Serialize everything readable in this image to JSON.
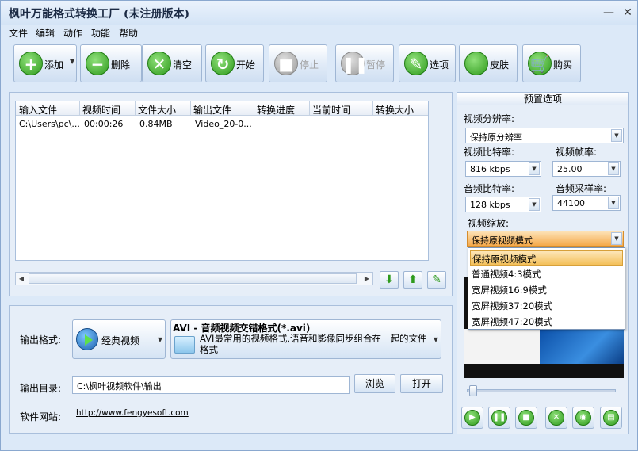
{
  "window": {
    "title": "枫叶万能格式转换工厂  (未注册版本)"
  },
  "menu": [
    "文件",
    "编辑",
    "动作",
    "功能",
    "帮助"
  ],
  "toolbar": [
    {
      "label": "添加",
      "icon": "plus-icon"
    },
    {
      "label": "删除",
      "icon": "minus-icon"
    },
    {
      "label": "清空",
      "icon": "clear-icon"
    },
    {
      "label": "开始",
      "icon": "refresh-icon"
    },
    {
      "label": "停止",
      "icon": "stop-icon"
    },
    {
      "label": "暂停",
      "icon": "pause-icon"
    },
    {
      "label": "选项",
      "icon": "options-icon"
    },
    {
      "label": "皮肤",
      "icon": "apple-icon"
    },
    {
      "label": "购买",
      "icon": "cart-icon"
    }
  ],
  "table": {
    "columns": [
      "输入文件",
      "视频时间",
      "文件大小",
      "输出文件",
      "转换进度",
      "当前时间",
      "转换大小"
    ],
    "rows": [
      [
        "C:\\Users\\pc\\...",
        "00:00:26",
        "0.84MB",
        "Video_20-0...",
        "",
        "",
        ""
      ]
    ]
  },
  "output": {
    "format_label": "输出格式:",
    "format_button": "经典视频",
    "format_title": "AVI - 音频视频交错格式(*.avi)",
    "format_desc": "AVI最常用的视频格式,语音和影像同步组合在一起的文件格式",
    "dir_label": "输出目录:",
    "dir_value": "C:\\枫叶视频软件\\输出",
    "browse": "浏览",
    "open": "打开",
    "site_label": "软件网站:",
    "site_url": "http://www.fengyesoft.com"
  },
  "preset": {
    "title": "预置选项",
    "resolution_label": "视频分辨率:",
    "resolution_value": "保持原分辨率",
    "vbitrate_label": "视频比特率:",
    "vbitrate_value": "816 kbps",
    "framerate_label": "视频帧率:",
    "framerate_value": "25.00",
    "abitrate_label": "音频比特率:",
    "abitrate_value": "128 kbps",
    "samplerate_label": "音频采样率:",
    "samplerate_value": "44100",
    "scale_label": "视频缩放:",
    "scale_value": "保持原视频模式",
    "scale_options": [
      "保持原视频模式",
      "普通视频4:3模式",
      "宽屏视频16:9模式",
      "宽屏视频37:20模式",
      "宽屏视频47:20模式"
    ]
  }
}
